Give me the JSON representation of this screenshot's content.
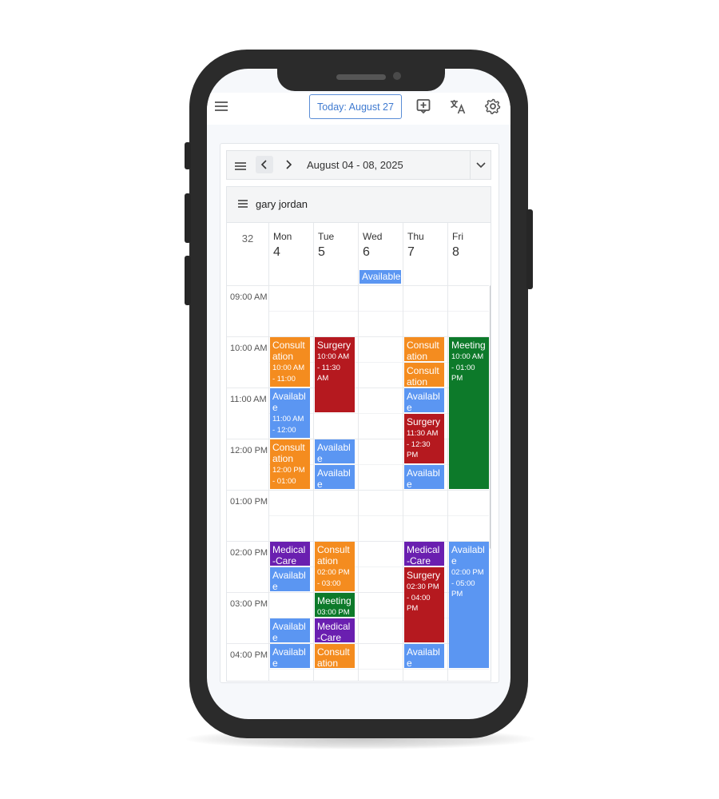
{
  "header": {
    "today_label": "Today: August 27",
    "menu_icon": "hamburger-icon",
    "icons": [
      "add-event-icon",
      "translate-icon",
      "gear-icon"
    ]
  },
  "navigation": {
    "date_range": "August 04 - 08, 2025",
    "prev_icon": "chevron-left-icon",
    "next_icon": "chevron-right-icon",
    "dropdown_icon": "chevron-down-icon"
  },
  "resource": {
    "name": "gary jordan"
  },
  "week_number": "32",
  "days": [
    {
      "name": "Mon",
      "num": "4"
    },
    {
      "name": "Tue",
      "num": "5"
    },
    {
      "name": "Wed",
      "num": "6"
    },
    {
      "name": "Thu",
      "num": "7"
    },
    {
      "name": "Fri",
      "num": "8"
    }
  ],
  "all_day_events": [
    {
      "day": 2,
      "title": "Available"
    }
  ],
  "time_labels": [
    "09:00 AM",
    "10:00 AM",
    "11:00 AM",
    "12:00 PM",
    "01:00 PM",
    "02:00 PM",
    "03:00 PM",
    "04:00 PM"
  ],
  "colors": {
    "consultation": "#f48c1f",
    "surgery": "#b5191f",
    "available": "#5b96f2",
    "meeting": "#0d7a2a",
    "medical": "#6a1fb0",
    "accent": "#3f7ad0"
  },
  "events": [
    {
      "day": 0,
      "start": 10.0,
      "end": 11.0,
      "title": "Consultation",
      "range": "10:00 AM - 11:00",
      "kind": "consultation"
    },
    {
      "day": 0,
      "start": 11.0,
      "end": 12.0,
      "title": "Available",
      "range": "11:00 AM - 12:00",
      "kind": "available"
    },
    {
      "day": 0,
      "start": 12.0,
      "end": 13.0,
      "title": "Consultation",
      "range": "12:00 PM - 01:00",
      "kind": "consultation"
    },
    {
      "day": 0,
      "start": 14.0,
      "end": 14.5,
      "title": "Medical-Care",
      "range": "",
      "kind": "medical"
    },
    {
      "day": 0,
      "start": 14.5,
      "end": 15.0,
      "title": "Available",
      "range": "",
      "kind": "available"
    },
    {
      "day": 0,
      "start": 15.5,
      "end": 16.0,
      "title": "Available",
      "range": "",
      "kind": "available"
    },
    {
      "day": 0,
      "start": 16.0,
      "end": 16.5,
      "title": "Available",
      "range": "",
      "kind": "available"
    },
    {
      "day": 1,
      "start": 10.0,
      "end": 11.5,
      "title": "Surgery",
      "range": "10:00 AM - 11:30 AM",
      "kind": "surgery"
    },
    {
      "day": 1,
      "start": 12.0,
      "end": 12.5,
      "title": "Available",
      "range": "",
      "kind": "available"
    },
    {
      "day": 1,
      "start": 12.5,
      "end": 13.0,
      "title": "Available",
      "range": "",
      "kind": "available"
    },
    {
      "day": 1,
      "start": 14.0,
      "end": 15.0,
      "title": "Consultation",
      "range": "02:00 PM - 03:00",
      "kind": "consultation"
    },
    {
      "day": 1,
      "start": 15.0,
      "end": 15.5,
      "title": "Meeting",
      "range": "03:00 PM",
      "kind": "meeting"
    },
    {
      "day": 1,
      "start": 15.5,
      "end": 16.0,
      "title": "Medical-Care",
      "range": "",
      "kind": "medical"
    },
    {
      "day": 1,
      "start": 16.0,
      "end": 16.5,
      "title": "Consultation",
      "range": "",
      "kind": "consultation"
    },
    {
      "day": 3,
      "start": 10.0,
      "end": 10.5,
      "title": "Consultation",
      "range": "",
      "kind": "consultation"
    },
    {
      "day": 3,
      "start": 10.5,
      "end": 11.0,
      "title": "Consultation",
      "range": "",
      "kind": "consultation"
    },
    {
      "day": 3,
      "start": 11.0,
      "end": 11.5,
      "title": "Available",
      "range": "",
      "kind": "available"
    },
    {
      "day": 3,
      "start": 11.5,
      "end": 12.5,
      "title": "Surgery",
      "range": "11:30 AM - 12:30 PM",
      "kind": "surgery"
    },
    {
      "day": 3,
      "start": 12.5,
      "end": 13.0,
      "title": "Available",
      "range": "",
      "kind": "available"
    },
    {
      "day": 3,
      "start": 14.0,
      "end": 14.5,
      "title": "Medical-Care",
      "range": "",
      "kind": "medical"
    },
    {
      "day": 3,
      "start": 14.5,
      "end": 16.0,
      "title": "Surgery",
      "range": "02:30 PM - 04:00 PM",
      "kind": "surgery"
    },
    {
      "day": 3,
      "start": 16.0,
      "end": 16.5,
      "title": "Available",
      "range": "",
      "kind": "available"
    },
    {
      "day": 4,
      "start": 10.0,
      "end": 13.0,
      "title": "Meeting",
      "range": "10:00 AM - 01:00 PM",
      "kind": "meeting"
    },
    {
      "day": 4,
      "start": 14.0,
      "end": 16.5,
      "title": "Available",
      "range": "02:00 PM - 05:00 PM",
      "kind": "available"
    }
  ]
}
